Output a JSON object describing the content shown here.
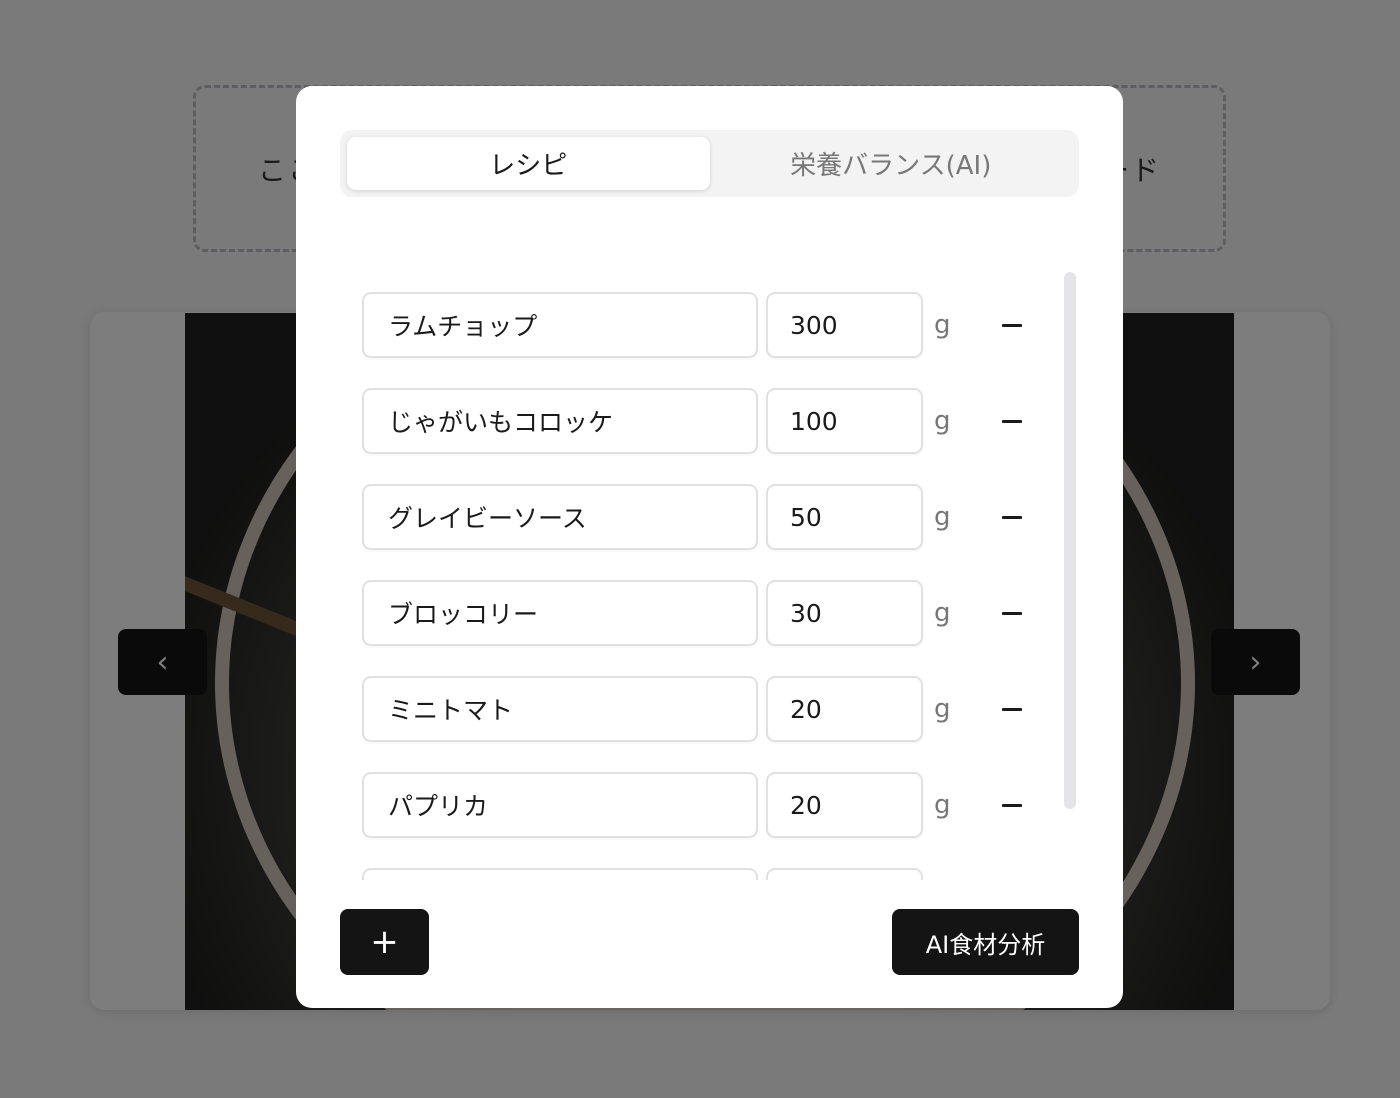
{
  "background": {
    "upload_text_left": "ここ",
    "upload_text_right": "ード"
  },
  "carousel": {
    "prev_icon": "chevron-left-icon",
    "next_icon": "chevron-right-icon",
    "prev_glyph": "‹",
    "next_glyph": "›"
  },
  "modal": {
    "tabs": [
      {
        "label": "レシピ",
        "active": true
      },
      {
        "label": "栄養バランス(AI)",
        "active": false
      }
    ],
    "unit_label": "g",
    "ingredients": [
      {
        "name": "ラムチョップ",
        "amount": "300"
      },
      {
        "name": "じゃがいもコロッケ",
        "amount": "100"
      },
      {
        "name": "グレイビーソース",
        "amount": "50"
      },
      {
        "name": "ブロッコリー",
        "amount": "30"
      },
      {
        "name": "ミニトマト",
        "amount": "20"
      },
      {
        "name": "パプリカ",
        "amount": "20"
      },
      {
        "name": "",
        "amount": ""
      }
    ],
    "add_button_label": "+",
    "ai_button_label": "AI食材分析",
    "colors": {
      "button_bg": "#141414",
      "overlay": "rgba(0,0,0,0.5)",
      "tab_inactive_text": "#777777"
    }
  }
}
